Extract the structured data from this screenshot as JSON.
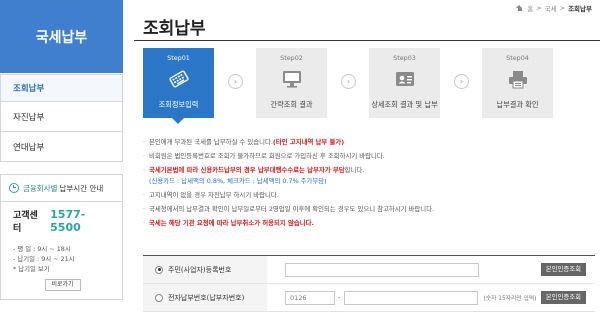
{
  "sidebar": {
    "title": "국세납부",
    "menu": [
      {
        "label": "조회납부",
        "active": true
      },
      {
        "label": "자진납부",
        "active": false
      },
      {
        "label": "연대납부",
        "active": false
      }
    ],
    "pay_time": {
      "prefix": "금융회사별",
      "label": "납부시간 안내"
    },
    "customer_center": {
      "label": "고객센터",
      "number": "1577-5500",
      "lines": [
        "- 평   일 : 9시 ~ 18시",
        "- 납기일 : 9시 ~ 21시",
        "* 납기일 보기"
      ],
      "button": "비로가기"
    }
  },
  "breadcrumb": {
    "home": "홈",
    "sep": ">",
    "level1": "국세",
    "current": "조회납부"
  },
  "page_title": "조회납부",
  "steps": [
    {
      "no": "Step01",
      "label": "조회정보입력",
      "icon": "keyboard-icon",
      "active": true
    },
    {
      "no": "Step02",
      "label": "간략조회 결과",
      "icon": "monitor-icon",
      "active": false
    },
    {
      "no": "Step03",
      "label": "상세조회 결과 및 납부",
      "icon": "id-card-icon",
      "active": false
    },
    {
      "no": "Step04",
      "label": "납부결과 확인",
      "icon": "printer-icon",
      "active": false
    }
  ],
  "notices": {
    "n1_text": "본인에게 부과된 국세를 납부하실 수 있습니다.",
    "n1_red": "(타인 고지내역 납부 불가)",
    "n2": "비회원은 법인등록번호로 조회가 불가하므로 회원으로 가입하신 후 조회하시기 바랍니다.",
    "n3_red": "국세기본법에 따라 신용카드납부의 경우 납부대행수수료는 납부자가 부담",
    "n3_tail": "합니다.",
    "n3_sub": "(신용카드 : 납세액의 0.8%, 체크카드 : 납세액의 0.7% 주가부담)",
    "n4": "고지내역이 없을 경우 자진납부 하시기 바랍니다.",
    "n5": "국세청에서의 납부결과 확인이 납부일로부터 2영업일 이후에 확인되는 경우도 있으니 참고하시기 바랍니다.",
    "n6_red": "국세는 해당 기관 요청에 따라 납부취소가 허용되지 않습니다."
  },
  "form": {
    "row1": {
      "label": "주민(사업자)등록번호",
      "value": "",
      "button": "본인인증조회",
      "checked": true
    },
    "row2": {
      "label": "전자납부번호(납부자번호)",
      "prefix_value": "0126",
      "value": "",
      "hint": "(숫자 15자리만 입력)",
      "button": "본인인증조회",
      "checked": false
    }
  },
  "colors": {
    "accent": "#2c76c8",
    "banner": "#3f7fcd",
    "warning": "#d21f1f",
    "teal": "#2fa5a0"
  }
}
